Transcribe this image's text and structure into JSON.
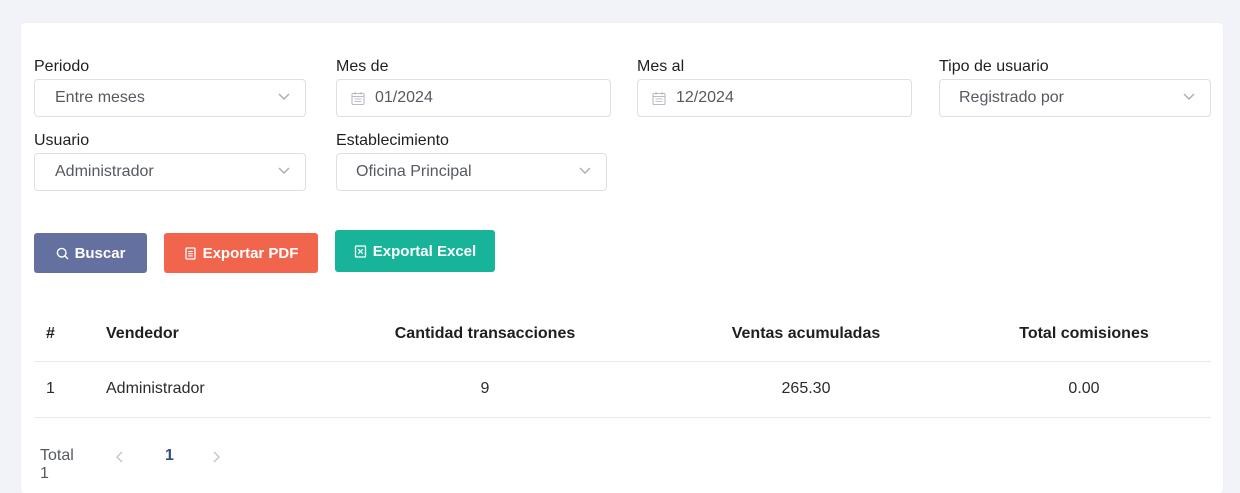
{
  "filters": {
    "periodo": {
      "label": "Periodo",
      "value": "Entre meses"
    },
    "mes_de": {
      "label": "Mes de",
      "value": "01/2024"
    },
    "mes_al": {
      "label": "Mes al",
      "value": "12/2024"
    },
    "tipo_usuario": {
      "label": "Tipo de usuario",
      "value": "Registrado por"
    },
    "usuario": {
      "label": "Usuario",
      "value": "Administrador"
    },
    "establecimiento": {
      "label": "Establecimiento",
      "value": "Oficina Principal"
    }
  },
  "buttons": {
    "buscar": {
      "label": "Buscar",
      "color": "#6470a0"
    },
    "pdf": {
      "label": "Exportar PDF",
      "color": "#f0654b"
    },
    "excel": {
      "label": "Exportal Excel",
      "color": "#17b49a"
    }
  },
  "table": {
    "headers": [
      "#",
      "Vendedor",
      "Cantidad transacciones",
      "Ventas acumuladas",
      "Total comisiones"
    ],
    "rows": [
      [
        "1",
        "Administrador",
        "9",
        "265.30",
        "0.00"
      ]
    ]
  },
  "pagination": {
    "total_label": "Total 1",
    "current_page": "1",
    "active_color": "#34507d"
  },
  "icons": {
    "select": "chevron-down-icon",
    "date": "calendar-icon",
    "search": "search-icon",
    "pdf": "document-icon",
    "excel": "excel-file-icon",
    "prev": "chevron-left-icon",
    "next": "chevron-right-icon"
  }
}
